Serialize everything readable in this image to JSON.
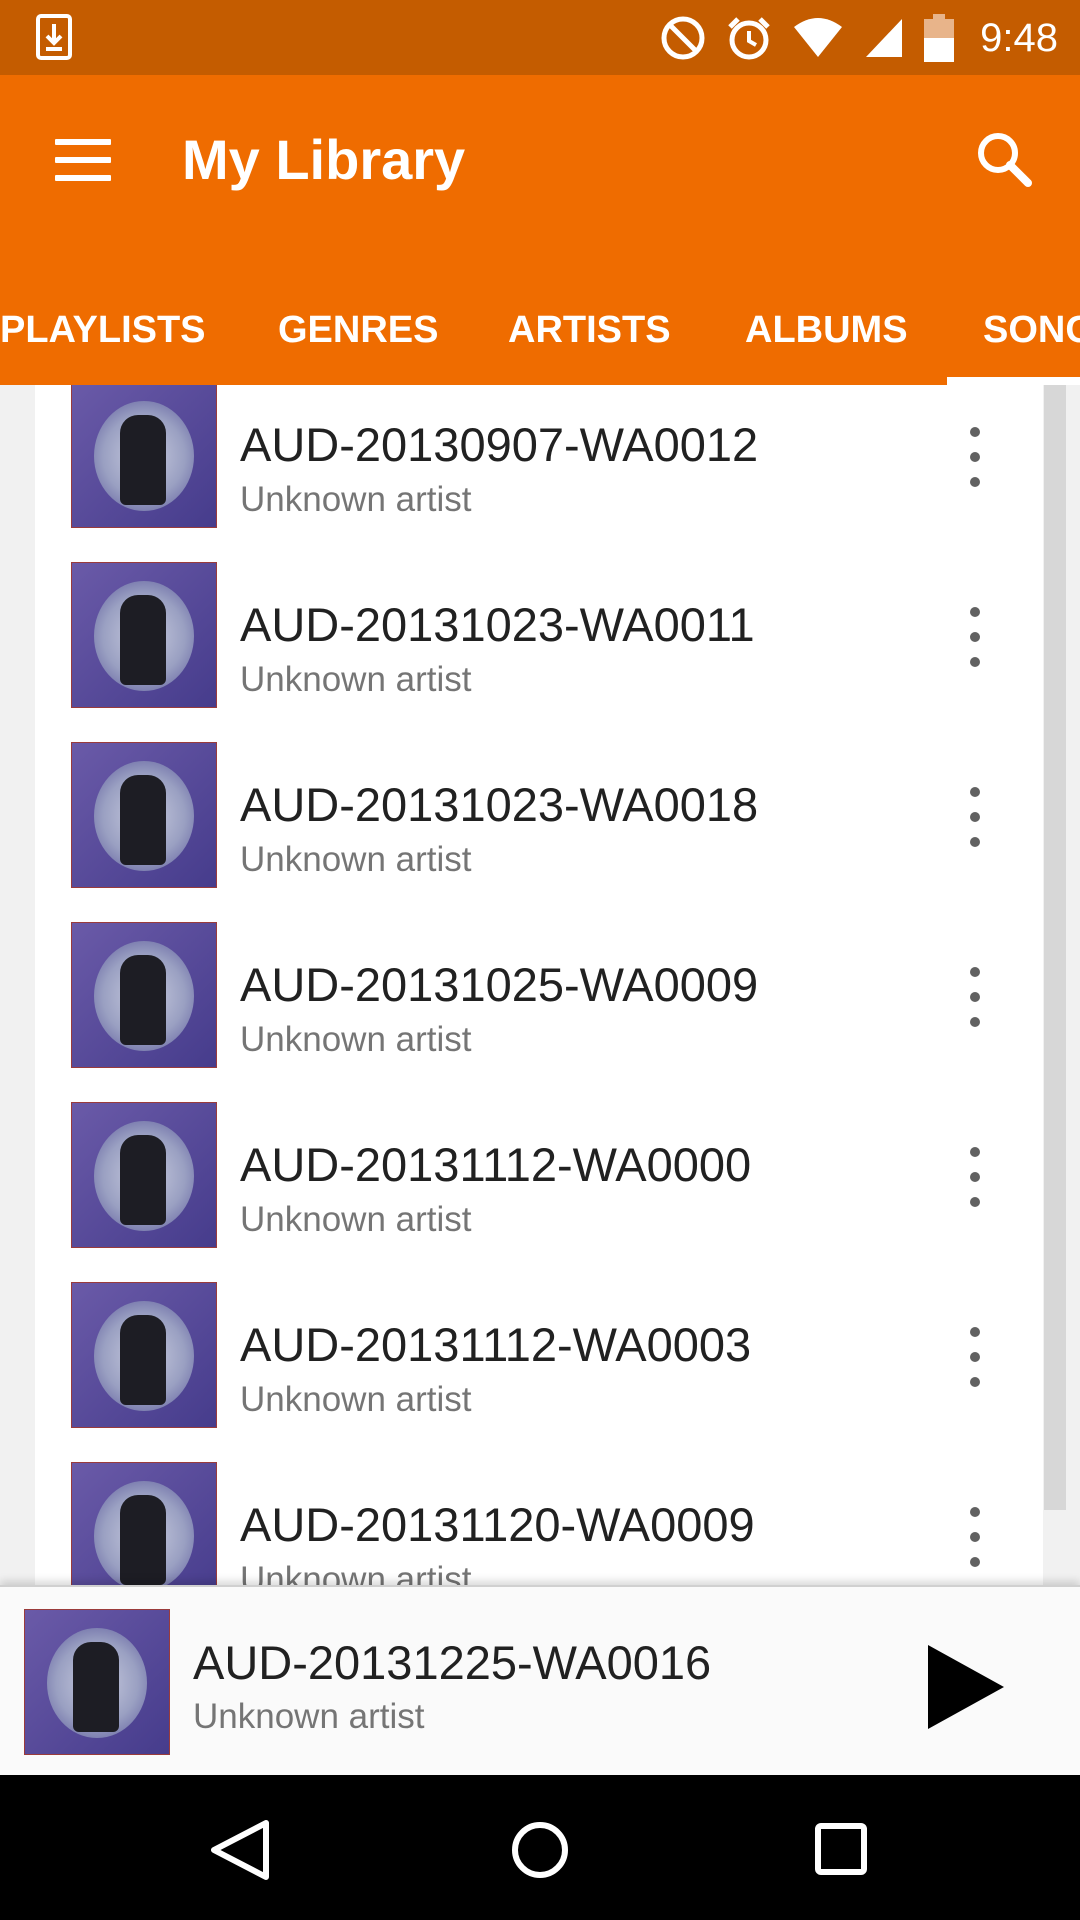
{
  "status_bar": {
    "time": "9:48",
    "icons": [
      "download-icon",
      "do-not-disturb-icon",
      "alarm-icon",
      "wifi-icon",
      "signal-icon",
      "battery-icon"
    ]
  },
  "app_bar": {
    "title": "My Library",
    "menu_icon": "menu-icon",
    "search_icon": "search-icon",
    "color": "#ef6c00"
  },
  "tabs": [
    {
      "label": "PLAYLISTS"
    },
    {
      "label": "GENRES"
    },
    {
      "label": "ARTISTS"
    },
    {
      "label": "ALBUMS"
    },
    {
      "label": "SONGS",
      "selected": true
    }
  ],
  "songs": [
    {
      "title": "AUD-20130907-WA0012",
      "artist": "Unknown artist"
    },
    {
      "title": "AUD-20131023-WA0011",
      "artist": "Unknown artist"
    },
    {
      "title": "AUD-20131023-WA0018",
      "artist": "Unknown artist"
    },
    {
      "title": "AUD-20131025-WA0009",
      "artist": "Unknown artist"
    },
    {
      "title": "AUD-20131112-WA0000",
      "artist": "Unknown artist"
    },
    {
      "title": "AUD-20131112-WA0003",
      "artist": "Unknown artist"
    },
    {
      "title": "AUD-20131120-WA0009",
      "artist": "Unknown artist"
    }
  ],
  "now_playing": {
    "title": "AUD-20131225-WA0016",
    "artist": "Unknown artist",
    "control_icon": "play-icon"
  },
  "nav_bar": {
    "icons": [
      "back-icon",
      "home-icon",
      "recents-icon"
    ]
  }
}
